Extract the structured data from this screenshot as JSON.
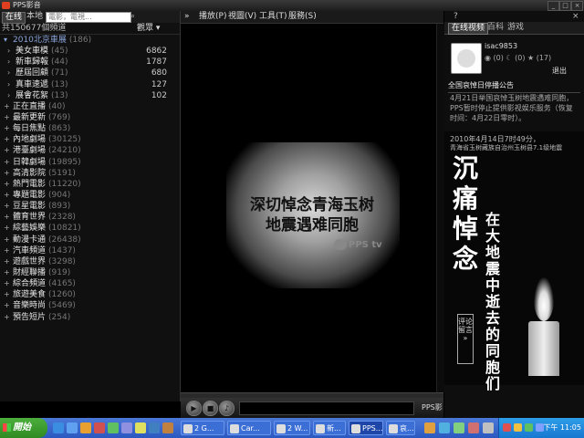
{
  "window": {
    "title": "PPS影音"
  },
  "left": {
    "tabs": [
      "在线",
      "本地"
    ],
    "search_placeholder": "電影，電視...",
    "count_text": "共150677個頻道",
    "view_label": "觀眾",
    "categories": [
      {
        "label": "2010北京車展",
        "count": "(186)",
        "kind": "top",
        "icon": "▾"
      },
      {
        "label": "美女車模",
        "count": "(45)",
        "num": "6862",
        "kind": "sub",
        "icon": "›"
      },
      {
        "label": "新車歸報",
        "count": "(44)",
        "num": "1787",
        "kind": "sub",
        "icon": "›"
      },
      {
        "label": "歷屆回顧",
        "count": "(71)",
        "num": "680",
        "kind": "sub",
        "icon": "›"
      },
      {
        "label": "真車速遞",
        "count": "(13)",
        "num": "127",
        "kind": "sub",
        "icon": "›"
      },
      {
        "label": "展會花絮",
        "count": "(13)",
        "num": "102",
        "kind": "sub",
        "icon": "›"
      },
      {
        "label": "正在直播",
        "count": "(40)",
        "kind": "main",
        "icon": "+"
      },
      {
        "label": "最新更新",
        "count": "(769)",
        "kind": "main",
        "icon": "+"
      },
      {
        "label": "每日焦點",
        "count": "(863)",
        "kind": "main",
        "icon": "+"
      },
      {
        "label": "內地劇場",
        "count": "(30125)",
        "kind": "main",
        "icon": "+"
      },
      {
        "label": "港臺劇場",
        "count": "(24210)",
        "kind": "main",
        "icon": "+"
      },
      {
        "label": "日韓劇場",
        "count": "(19895)",
        "kind": "main",
        "icon": "+"
      },
      {
        "label": "高清影院",
        "count": "(5191)",
        "kind": "main",
        "icon": "+"
      },
      {
        "label": "熱門電影",
        "count": "(11220)",
        "kind": "main",
        "icon": "+"
      },
      {
        "label": "專題電影",
        "count": "(904)",
        "kind": "main",
        "icon": "+"
      },
      {
        "label": "豆星電影",
        "count": "(893)",
        "kind": "main",
        "icon": "+"
      },
      {
        "label": "體育世界",
        "count": "(2328)",
        "kind": "main",
        "icon": "+"
      },
      {
        "label": "綜藝娛樂",
        "count": "(10821)",
        "kind": "main",
        "icon": "+"
      },
      {
        "label": "動漫卡通",
        "count": "(26438)",
        "kind": "main",
        "icon": "+"
      },
      {
        "label": "汽車頻道",
        "count": "(1437)",
        "kind": "main",
        "icon": "+"
      },
      {
        "label": "遊戲世界",
        "count": "(3298)",
        "kind": "main",
        "icon": "+"
      },
      {
        "label": "財經聯播",
        "count": "(919)",
        "kind": "main",
        "icon": "+"
      },
      {
        "label": "綜合頻道",
        "count": "(4165)",
        "kind": "main",
        "icon": "+"
      },
      {
        "label": "旅遊美食",
        "count": "(1260)",
        "kind": "main",
        "icon": "+"
      },
      {
        "label": "音樂時尚",
        "count": "(5469)",
        "kind": "main",
        "icon": "+"
      },
      {
        "label": "預告短片",
        "count": "(254)",
        "kind": "main",
        "icon": "+"
      }
    ]
  },
  "toolbar": {
    "collapse": "»",
    "play": "播放(P)",
    "view": "視圖(V)",
    "tools": "工具(T)",
    "service": "服務(S)"
  },
  "video": {
    "line1": "深切悼念青海玉树",
    "line2": "地震遇难同胞",
    "logo": "PPS tv"
  },
  "controls": {
    "brand": "PPS影"
  },
  "right": {
    "help": "?",
    "close": "×",
    "tabs": [
      "在线视频",
      "百科",
      "游戏"
    ],
    "username": "isac9853",
    "stats": "◉ (0)  ☾ (0)  ★ (17)",
    "logout": "退出",
    "announcement_title": "全国哀悼日停播公告",
    "announcement": "4月21日举国哀悼玉树地震遇难同胞，PPS暂时停止提供影视娱乐服务（恢复时间：4月22日零时）。",
    "banner_date": "2010年4月14日7时49分，",
    "banner_sub": "青海省玉树藏族自治州玉树县7.1级地震",
    "banner_big": [
      "沉",
      "痛",
      "悼",
      "念"
    ],
    "banner_col": [
      "在",
      "大",
      "地",
      "震",
      "中",
      "逝",
      "去",
      "的",
      "同",
      "胞",
      "们"
    ],
    "banner_comment": "评论留言 »"
  },
  "taskbar": {
    "start": "開始",
    "tasks": [
      "2 G...",
      "Car...",
      "2 W...",
      "新...",
      "PPS...",
      "哀..."
    ],
    "clock": "下午 11:05"
  }
}
